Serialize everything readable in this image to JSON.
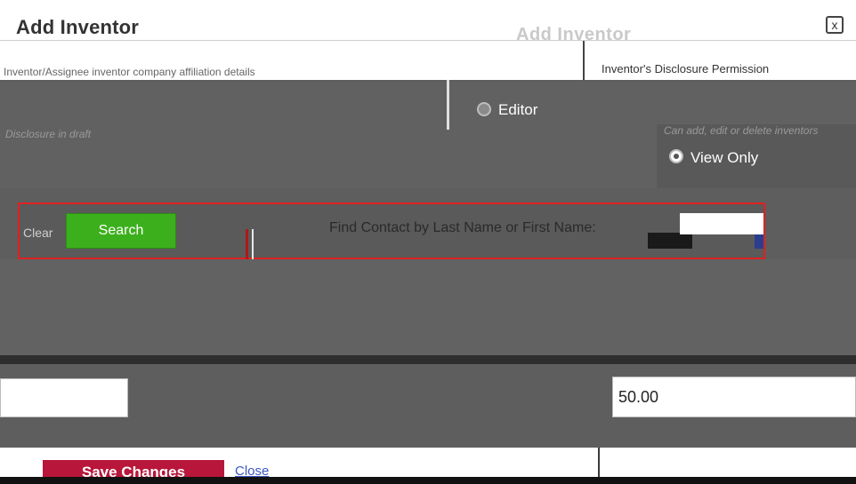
{
  "dialog": {
    "title": "Add Inventor",
    "close_symbol": "x",
    "ghost_title": "Add Inventor"
  },
  "left_strip": {
    "text": "Inventor/Assignee inventor company affiliation details"
  },
  "right_panel": {
    "text": "Inventor's Disclosure Permission"
  },
  "notes": {
    "left": "Disclosure in draft",
    "right": "Can add, edit or delete inventors"
  },
  "permissions": {
    "editor_label": "Editor",
    "view_only_label": "View Only",
    "selected": "View Only"
  },
  "search": {
    "button_label": "Search",
    "clear_label": "Clear",
    "prompt": "Find Contact by Last Name or First Name:",
    "input_value": ""
  },
  "form": {
    "left_input_value": "",
    "percent_value": "50.00"
  },
  "footer": {
    "save_label": "Save Changes",
    "close_label": "Close"
  },
  "colors": {
    "search_button": "#3cb01c",
    "save_button": "#b8163a",
    "highlight_border": "#e02020",
    "link": "#3b56c4"
  },
  "icons": {
    "close": "close-icon"
  }
}
